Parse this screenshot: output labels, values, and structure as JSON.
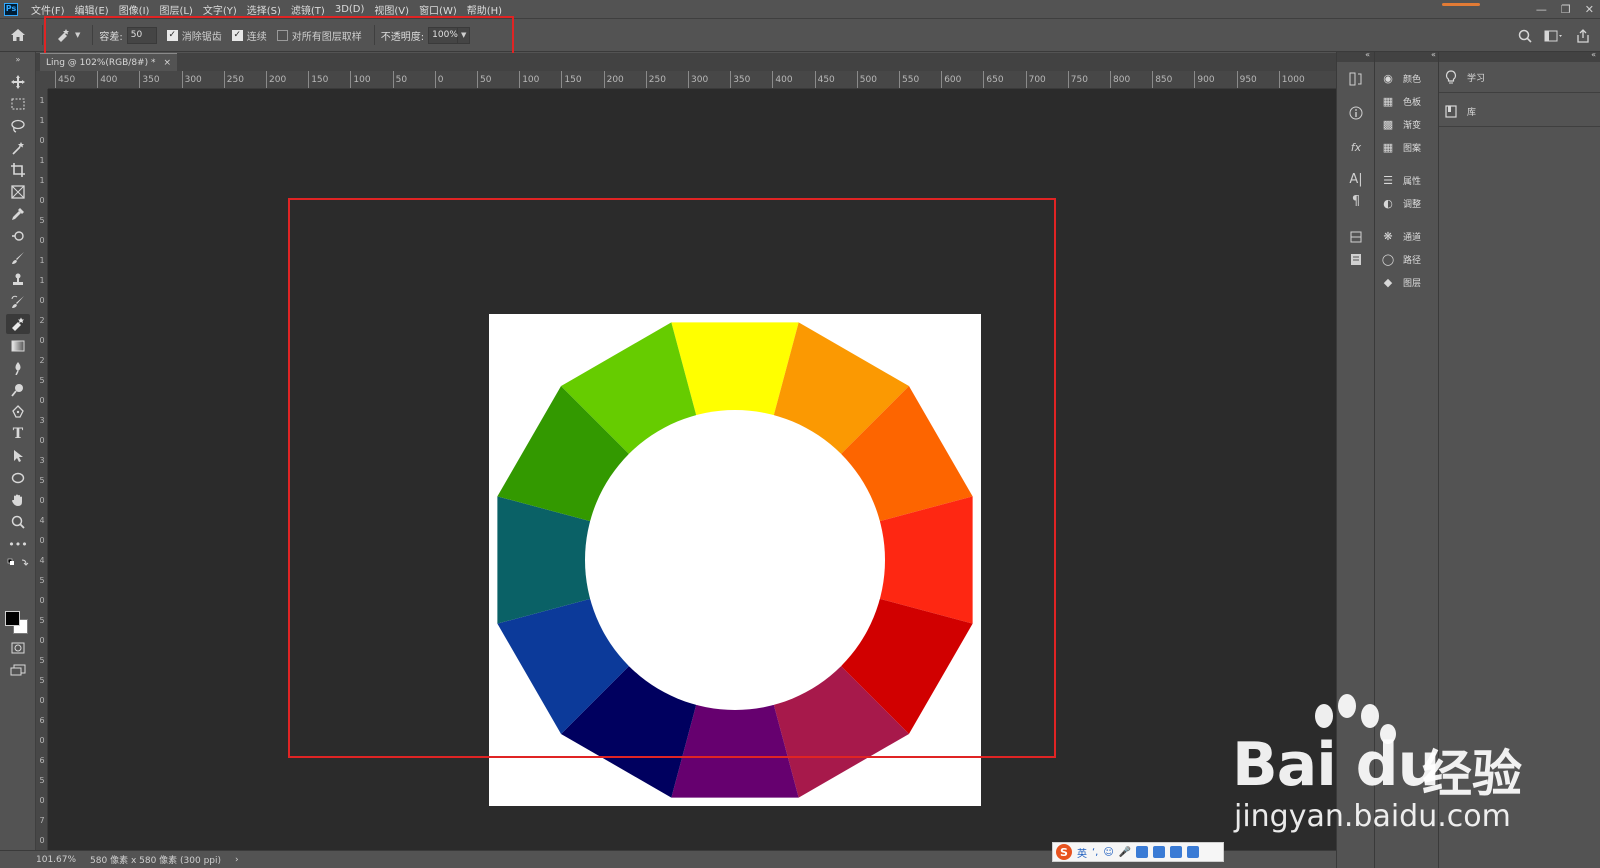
{
  "app": {
    "logo": "Ps"
  },
  "menu": {
    "items": [
      "文件(F)",
      "编辑(E)",
      "图像(I)",
      "图层(L)",
      "文字(Y)",
      "选择(S)",
      "滤镜(T)",
      "3D(D)",
      "视图(V)",
      "窗口(W)",
      "帮助(H)"
    ]
  },
  "options": {
    "tolerance_label": "容差:",
    "tolerance_value": "50",
    "anti_alias_label": "消除锯齿",
    "anti_alias_checked": true,
    "contiguous_label": "连续",
    "contiguous_checked": true,
    "sample_all_label": "对所有图层取样",
    "sample_all_checked": false,
    "opacity_label": "不透明度:",
    "opacity_value": "100%"
  },
  "document": {
    "tab_title": "Ling @ 102%(RGB/8#) *",
    "tab_close": "×"
  },
  "ruler": {
    "h_labels": [
      "450",
      "400",
      "350",
      "300",
      "250",
      "200",
      "150",
      "100",
      "50",
      "0",
      "50",
      "100",
      "150",
      "200",
      "250",
      "300",
      "350",
      "400",
      "450",
      "500",
      "550",
      "600",
      "650",
      "700",
      "750",
      "800",
      "850",
      "900",
      "950",
      "1000"
    ],
    "v_labels": [
      "100",
      "150",
      "0",
      "100",
      "150",
      "0",
      "5",
      "0",
      "100",
      "150",
      "0",
      "2",
      "0",
      "2",
      "5",
      "0",
      "3",
      "0",
      "3",
      "5",
      "0",
      "4",
      "0",
      "4",
      "5",
      "0",
      "5",
      "0",
      "5",
      "5",
      "0",
      "6",
      "0",
      "6",
      "5",
      "0",
      "7",
      "0"
    ]
  },
  "status": {
    "zoom": "101.67%",
    "doc_info": "580 像素 x 580 像素 (300 ppi)",
    "arrow": "›"
  },
  "color_wheel": {
    "segments": [
      "#ffff00",
      "#fb9902",
      "#fd6500",
      "#fe2712",
      "#d10000",
      "#a7194b",
      "#66006f",
      "#00005f",
      "#0c3a9a",
      "#0a6166",
      "#339900",
      "#66cc00"
    ]
  },
  "panels": {
    "collapsed": [
      {
        "icon": "color-icon",
        "label": "颜色"
      },
      {
        "icon": "swatches-icon",
        "label": "色板"
      },
      {
        "icon": "gradient-icon",
        "label": "渐变"
      },
      {
        "icon": "patterns-icon",
        "label": "图案"
      },
      {
        "icon": "properties-icon",
        "label": "属性"
      },
      {
        "icon": "adjustments-icon",
        "label": "调整"
      },
      {
        "icon": "channels-icon",
        "label": "通道"
      },
      {
        "icon": "paths-icon",
        "label": "路径"
      },
      {
        "icon": "layers-icon",
        "label": "图层"
      }
    ],
    "far": [
      {
        "icon": "learn-icon",
        "label": "学习"
      },
      {
        "icon": "libraries-icon",
        "label": "库"
      }
    ]
  },
  "watermark": {
    "brand": "Bai du",
    "cn": "经验",
    "url": "jingyan.baidu.com"
  },
  "ime": {
    "logo": "S",
    "mode": "英"
  },
  "colors": {
    "highlight": "#e02424",
    "canvas_bg": "#2b2b2b",
    "ui_bg": "#535353"
  }
}
